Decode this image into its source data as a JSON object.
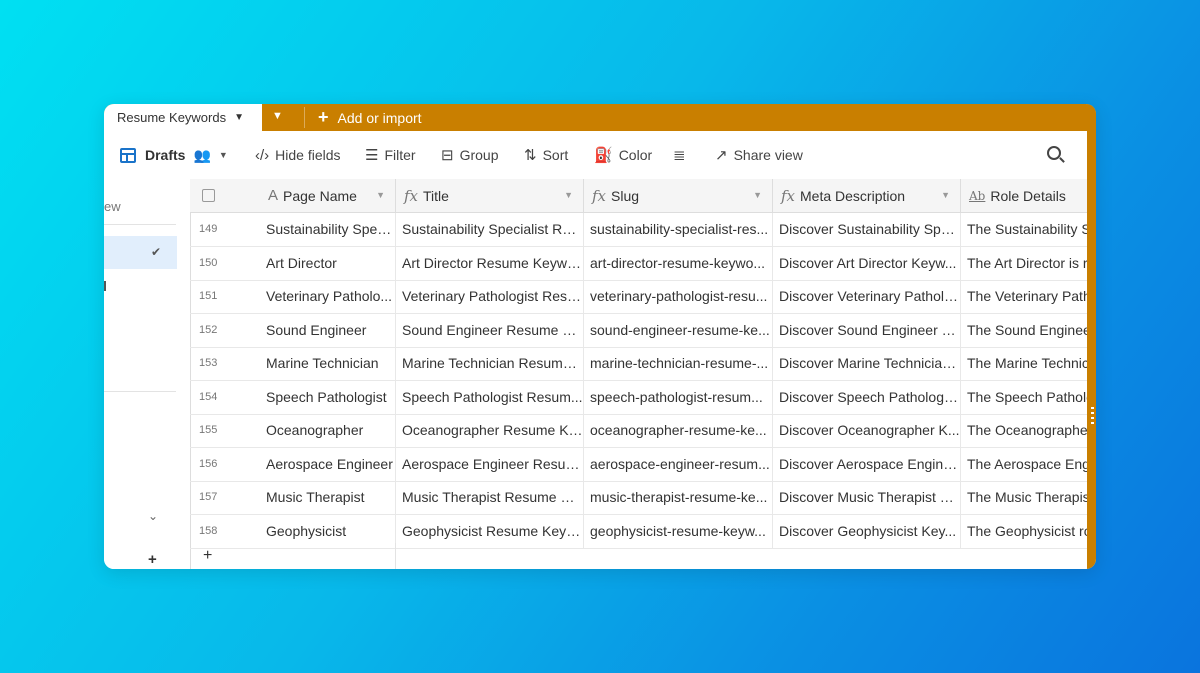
{
  "tabs": {
    "active_label": "Resume Keywords",
    "add_import_label": "Add or import"
  },
  "toolbar": {
    "view_name": "Drafts",
    "hide_fields": "Hide fields",
    "filter": "Filter",
    "group": "Group",
    "sort": "Sort",
    "color": "Color",
    "share_view": "Share view"
  },
  "sidebar": {
    "partial_text": "ew"
  },
  "table": {
    "columns": [
      {
        "label": "Page Name",
        "type": "text"
      },
      {
        "label": "Title",
        "type": "formula"
      },
      {
        "label": "Slug",
        "type": "formula"
      },
      {
        "label": "Meta Description",
        "type": "formula"
      },
      {
        "label": "Role Details",
        "type": "long-text"
      }
    ],
    "rows": [
      {
        "n": "149",
        "page": "Sustainability Spec...",
        "title": "Sustainability Specialist Res...",
        "slug": "sustainability-specialist-res...",
        "meta": "Discover Sustainability Spe...",
        "role": "The Sustainability Sp"
      },
      {
        "n": "150",
        "page": "Art Director",
        "title": "Art Director Resume Keywo...",
        "slug": "art-director-resume-keywo...",
        "meta": "Discover Art Director Keyw...",
        "role": "The Art Director is re"
      },
      {
        "n": "151",
        "page": "Veterinary Patholo...",
        "title": "Veterinary Pathologist Resu...",
        "slug": "veterinary-pathologist-resu...",
        "meta": "Discover Veterinary Patholo...",
        "role": "The Veterinary Patho"
      },
      {
        "n": "152",
        "page": "Sound Engineer",
        "title": "Sound Engineer Resume Ke...",
        "slug": "sound-engineer-resume-ke...",
        "meta": "Discover Sound Engineer K...",
        "role": "The Sound Engineer"
      },
      {
        "n": "153",
        "page": "Marine Technician",
        "title": "Marine Technician Resume ...",
        "slug": "marine-technician-resume-...",
        "meta": "Discover Marine Technician...",
        "role": "The Marine Technici"
      },
      {
        "n": "154",
        "page": "Speech Pathologist",
        "title": "Speech Pathologist Resum...",
        "slug": "speech-pathologist-resum...",
        "meta": "Discover Speech Pathologis...",
        "role": "The Speech Patholo"
      },
      {
        "n": "155",
        "page": "Oceanographer",
        "title": "Oceanographer Resume Ke...",
        "slug": "oceanographer-resume-ke...",
        "meta": "Discover Oceanographer K...",
        "role": "The Oceanographer"
      },
      {
        "n": "156",
        "page": "Aerospace Engineer",
        "title": "Aerospace Engineer Resum...",
        "slug": "aerospace-engineer-resum...",
        "meta": "Discover Aerospace Engine...",
        "role": "The Aerospace Engi"
      },
      {
        "n": "157",
        "page": "Music Therapist",
        "title": "Music Therapist Resume Ke...",
        "slug": "music-therapist-resume-ke...",
        "meta": "Discover Music Therapist K...",
        "role": "The Music Therapist"
      },
      {
        "n": "158",
        "page": "Geophysicist",
        "title": "Geophysicist Resume Keyw...",
        "slug": "geophysicist-resume-keyw...",
        "meta": "Discover Geophysicist Key...",
        "role": "The Geophysicist ro"
      }
    ]
  },
  "colors": {
    "accent": "#c97f00",
    "view_icon": "#1a73c9",
    "selected_bg": "#e1eefc"
  }
}
